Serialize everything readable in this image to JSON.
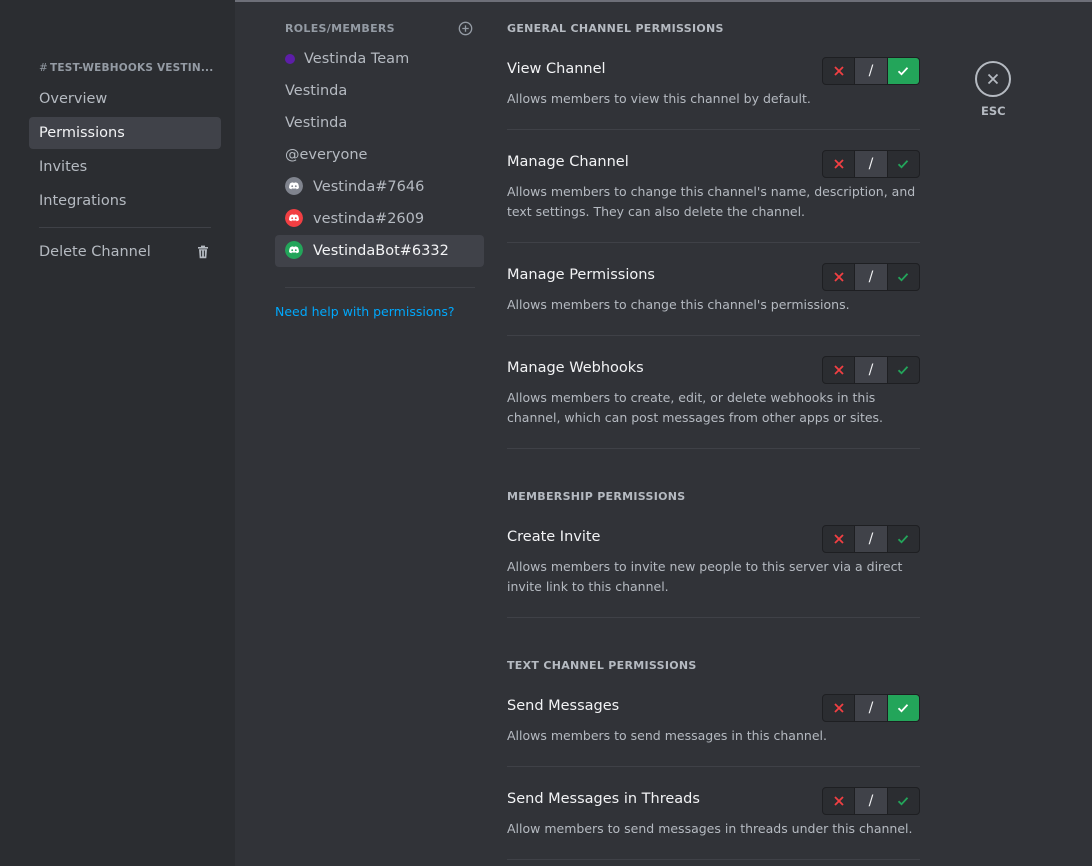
{
  "sidebar": {
    "channel_header": "TEST-WEBHOOKS VESTIN...",
    "items": [
      {
        "label": "Overview"
      },
      {
        "label": "Permissions"
      },
      {
        "label": "Invites"
      },
      {
        "label": "Integrations"
      }
    ],
    "delete_label": "Delete Channel"
  },
  "roles": {
    "header": "ROLES/MEMBERS",
    "items": [
      {
        "label": "Vestinda Team",
        "kind": "role-dot",
        "color": "#5d1ea8"
      },
      {
        "label": "Vestinda"
      },
      {
        "label": "Vestinda"
      },
      {
        "label": "@everyone"
      },
      {
        "label": "Vestinda#7646",
        "kind": "avatar",
        "color": "#80848e"
      },
      {
        "label": "vestinda#2609",
        "kind": "avatar",
        "color": "#f23f43"
      },
      {
        "label": "VestindaBot#6332",
        "kind": "avatar",
        "color": "#23a55a"
      }
    ],
    "help_link": "Need help with permissions?"
  },
  "sections": [
    {
      "title": "GENERAL CHANNEL PERMISSIONS",
      "permissions": [
        {
          "name": "View Channel",
          "description": "Allows members to view this channel by default.",
          "state": "allow"
        },
        {
          "name": "Manage Channel",
          "description": "Allows members to change this channel's name, description, and text settings. They can also delete the channel.",
          "state": "neutral"
        },
        {
          "name": "Manage Permissions",
          "description": "Allows members to change this channel's permissions.",
          "state": "neutral"
        },
        {
          "name": "Manage Webhooks",
          "description": "Allows members to create, edit, or delete webhooks in this channel, which can post messages from other apps or sites.",
          "state": "neutral"
        }
      ]
    },
    {
      "title": "MEMBERSHIP PERMISSIONS",
      "permissions": [
        {
          "name": "Create Invite",
          "description": "Allows members to invite new people to this server via a direct invite link to this channel.",
          "state": "neutral"
        }
      ]
    },
    {
      "title": "TEXT CHANNEL PERMISSIONS",
      "permissions": [
        {
          "name": "Send Messages",
          "description": "Allows members to send messages in this channel.",
          "state": "allow"
        },
        {
          "name": "Send Messages in Threads",
          "description": "Allow members to send messages in threads under this channel.",
          "state": "neutral"
        }
      ]
    }
  ],
  "toggle": {
    "neutral_symbol": "/"
  },
  "esc_label": "ESC",
  "colors": {
    "accent_green": "#23a55a",
    "deny_red": "#f23f43",
    "link_blue": "#00a8fc"
  }
}
